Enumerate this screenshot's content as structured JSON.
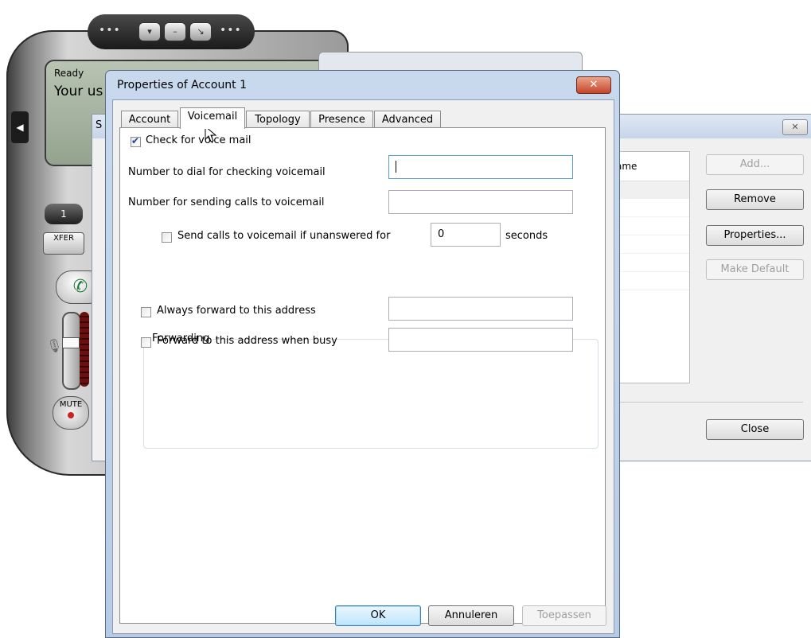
{
  "phone": {
    "status": "Ready",
    "user_text": "Your us",
    "key_label": "1",
    "xfer_label": "XFER",
    "mute_label": "MUTE",
    "top_buttons": [
      "▾",
      "–",
      "↘"
    ]
  },
  "bg_window": {
    "title_fragment": "S",
    "close_label": "✕",
    "list_header": "ame",
    "buttons": {
      "add": "Add...",
      "remove": "Remove",
      "properties": "Properties...",
      "make_default": "Make Default",
      "close": "Close"
    }
  },
  "dialog": {
    "title": "Properties of Account 1",
    "close_label": "✕",
    "tabs": [
      "Account",
      "Voicemail",
      "Topology",
      "Presence",
      "Advanced"
    ],
    "active_tab": "Voicemail",
    "check_voicemail_label": "Check for voice mail",
    "check_voicemail_checked": true,
    "dial_number_label": "Number to dial for checking voicemail",
    "dial_number_value": "",
    "send_number_label": "Number for sending calls to voicemail",
    "send_number_value": "",
    "unanswered_label": "Send calls to voicemail if unanswered for",
    "unanswered_checked": false,
    "unanswered_seconds": "0",
    "seconds_label": "seconds",
    "forwarding": {
      "legend": "Forwarding",
      "always_label": "Always forward to this address",
      "always_checked": false,
      "always_value": "",
      "busy_label": "Forward to this address when busy",
      "busy_checked": false,
      "busy_value": ""
    },
    "buttons": {
      "ok": "OK",
      "cancel": "Annuleren",
      "apply": "Toepassen"
    }
  }
}
